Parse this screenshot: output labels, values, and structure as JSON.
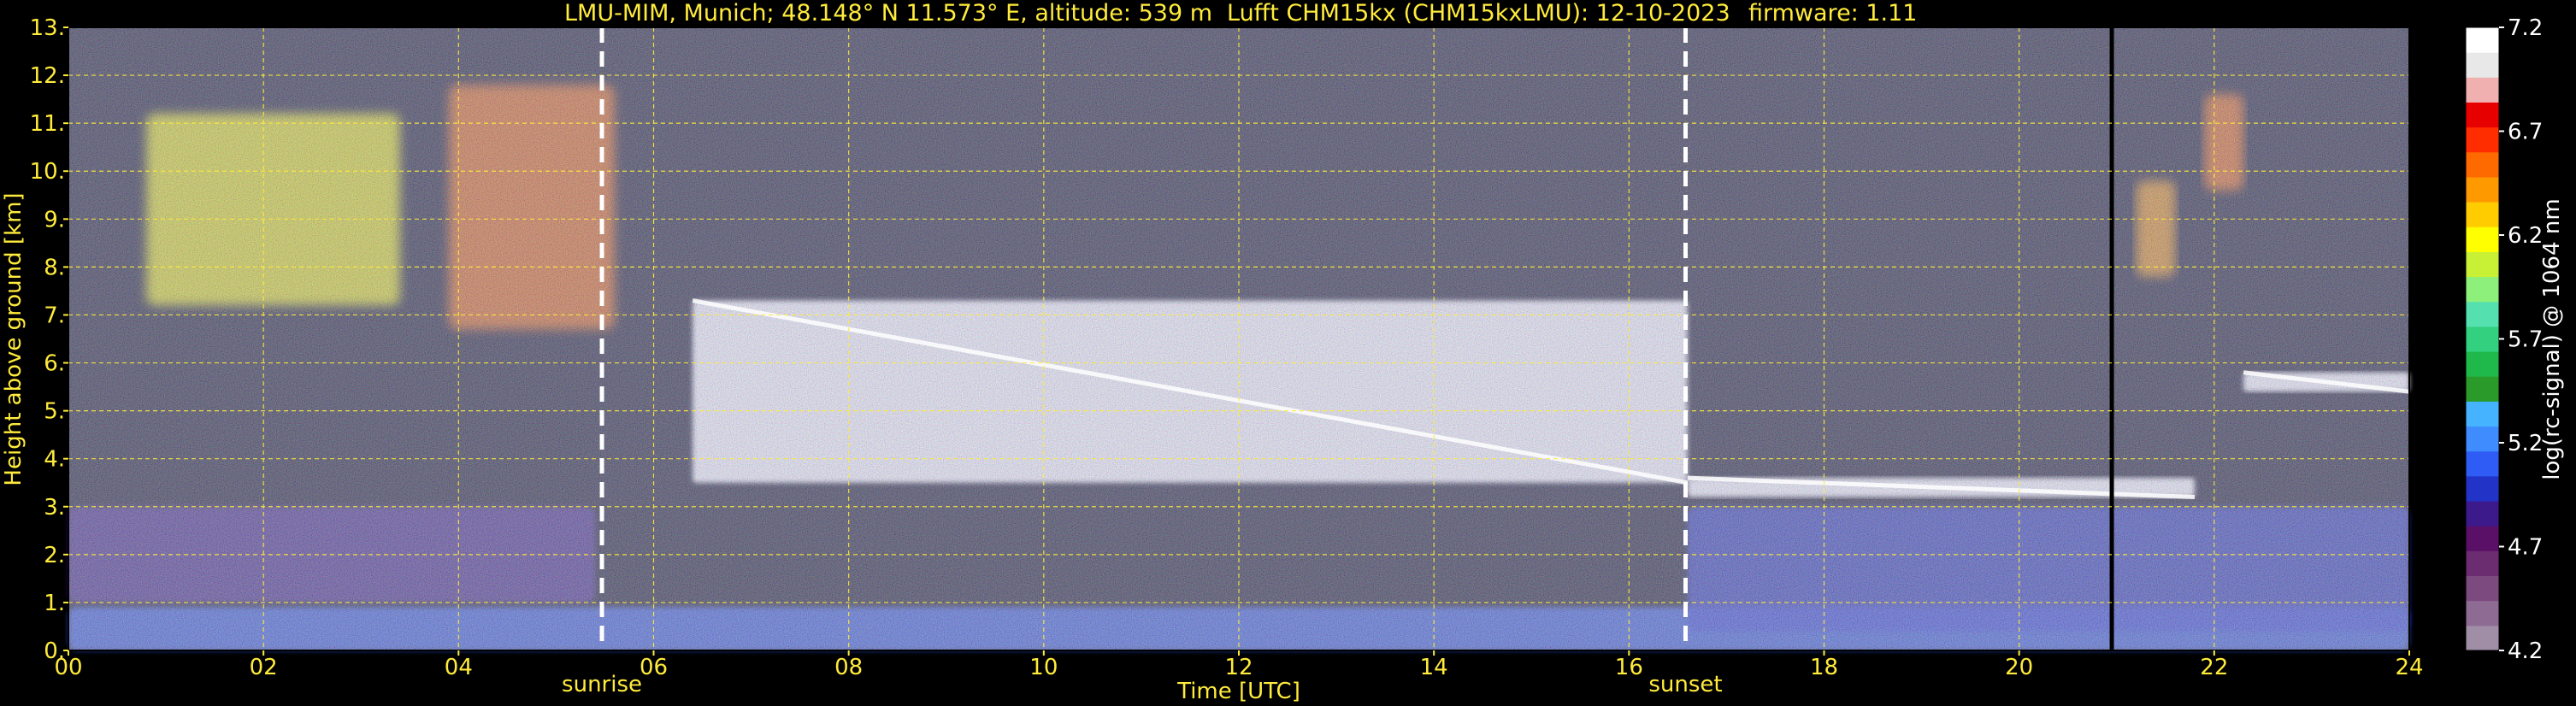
{
  "chart_data": {
    "type": "heatmap",
    "title_parts": [
      "LMU-MIM, Munich; 48.148° N 11.573° E, altitude: 539 m",
      "Lufft CHM15kx (CHM15kxLMU): 12-10-2023",
      "firmware: 1.11"
    ],
    "xlabel": "Time [UTC]",
    "ylabel": "Height above ground [km]",
    "xlim": [
      0,
      24
    ],
    "ylim": [
      0,
      13
    ],
    "x_ticks": [
      {
        "value": 0,
        "label": "00"
      },
      {
        "value": 2,
        "label": "02"
      },
      {
        "value": 4,
        "label": "04"
      },
      {
        "value": 6,
        "label": "06"
      },
      {
        "value": 8,
        "label": "08"
      },
      {
        "value": 10,
        "label": "10"
      },
      {
        "value": 12,
        "label": "12"
      },
      {
        "value": 14,
        "label": "14"
      },
      {
        "value": 16,
        "label": "16"
      },
      {
        "value": 18,
        "label": "18"
      },
      {
        "value": 20,
        "label": "20"
      },
      {
        "value": 22,
        "label": "22"
      },
      {
        "value": 24,
        "label": "24"
      }
    ],
    "y_ticks": [
      {
        "value": 0,
        "label": "0."
      },
      {
        "value": 1,
        "label": "1."
      },
      {
        "value": 2,
        "label": "2."
      },
      {
        "value": 3,
        "label": "3."
      },
      {
        "value": 4,
        "label": "4."
      },
      {
        "value": 5,
        "label": "5."
      },
      {
        "value": 6,
        "label": "6."
      },
      {
        "value": 7,
        "label": "7."
      },
      {
        "value": 8,
        "label": "8."
      },
      {
        "value": 9,
        "label": "9."
      },
      {
        "value": 10,
        "label": "10."
      },
      {
        "value": 11,
        "label": "11."
      },
      {
        "value": 12,
        "label": "12."
      },
      {
        "value": 13,
        "label": "13."
      }
    ],
    "grid": true,
    "grid_color": "#ffeb3b",
    "markers": [
      {
        "name": "sunrise",
        "label": "sunrise",
        "x": 5.47
      },
      {
        "name": "sunset",
        "label": "sunset",
        "x": 16.58
      }
    ],
    "data_gap_x": 20.95,
    "colorbar": {
      "label": "log(rc-signal) @ 1064 nm",
      "range": [
        4.2,
        7.2
      ],
      "ticks": [
        {
          "value": 4.2,
          "label": "4.2"
        },
        {
          "value": 4.7,
          "label": "4.7"
        },
        {
          "value": 5.2,
          "label": "5.2"
        },
        {
          "value": 5.7,
          "label": "5.7"
        },
        {
          "value": 6.2,
          "label": "6.2"
        },
        {
          "value": 6.7,
          "label": "6.7"
        },
        {
          "value": 7.2,
          "label": "7.2"
        }
      ],
      "colors": [
        "#a08ea6",
        "#8e6b92",
        "#7d4a80",
        "#6c2c70",
        "#5a1066",
        "#3d1a8c",
        "#2233c8",
        "#2f5cf5",
        "#3f8cff",
        "#45b3ff",
        "#2a9a2a",
        "#1fb84a",
        "#33d080",
        "#55e0b0",
        "#8cf07a",
        "#c8f035",
        "#ffff00",
        "#ffcc00",
        "#ff9900",
        "#ff6a00",
        "#ff2d00",
        "#e60000",
        "#f0b0b0",
        "#e8e8e8",
        "#ffffff"
      ]
    },
    "features": [
      {
        "type": "aerosol_layer",
        "x": [
          0,
          5.4
        ],
        "y": [
          1.0,
          3.0
        ],
        "level": 4.85
      },
      {
        "type": "surface_layer",
        "x": [
          0,
          24
        ],
        "y": [
          0,
          0.9
        ],
        "level": 5.1
      },
      {
        "type": "night_aerosol_layer",
        "x": [
          16.6,
          24
        ],
        "y": [
          0.4,
          3.0
        ],
        "level": 5.0
      },
      {
        "type": "cirrus",
        "x": [
          0.8,
          3.4
        ],
        "y": [
          7.2,
          11.2
        ],
        "level": 6.2
      },
      {
        "type": "cirrus",
        "x": [
          3.9,
          5.6
        ],
        "y": [
          6.7,
          11.8
        ],
        "level": 6.5
      },
      {
        "type": "cloud_layer",
        "x": [
          6.4,
          16.6
        ],
        "y": [
          3.5,
          7.3
        ],
        "level": 7.2
      },
      {
        "type": "cloud_layer",
        "x": [
          16.6,
          21.8
        ],
        "y": [
          3.2,
          3.6
        ],
        "level": 7.2
      },
      {
        "type": "cloud_layer",
        "x": [
          22.3,
          24
        ],
        "y": [
          5.4,
          5.8
        ],
        "level": 7.2
      },
      {
        "type": "cirrus",
        "x": [
          21.2,
          21.6
        ],
        "y": [
          7.8,
          9.8
        ],
        "level": 6.4
      },
      {
        "type": "cirrus",
        "x": [
          21.9,
          22.3
        ],
        "y": [
          9.6,
          11.6
        ],
        "level": 6.5
      }
    ]
  }
}
